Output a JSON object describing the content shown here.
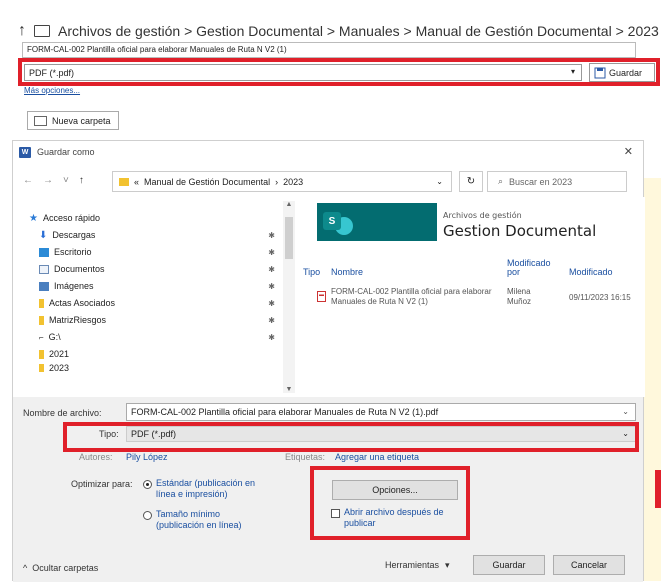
{
  "backstage": {
    "path": "Archivos de gestión > Gestion Documental > Manuales > Manual de Gestión Documental > 2023",
    "filename": "FORM-CAL-002 Plantilla oficial para elaborar Manuales de Ruta N V2 (1)",
    "type_value": "PDF (*.pdf)",
    "save_label": "Guardar",
    "more_options": "Más opciones...",
    "new_folder": "Nueva carpeta"
  },
  "dialog": {
    "title": "Guardar como",
    "address": {
      "location": "Manual de Gestión Documental",
      "separator": "›",
      "current": "2023",
      "search_placeholder": "Buscar en 2023"
    },
    "nav": [
      {
        "label": "Acceso rápido",
        "icon": "star-icon",
        "pinned": false
      },
      {
        "label": "Descargas",
        "icon": "download-icon",
        "pinned": true
      },
      {
        "label": "Escritorio",
        "icon": "desktop-icon",
        "pinned": true
      },
      {
        "label": "Documentos",
        "icon": "documents-icon",
        "pinned": true
      },
      {
        "label": "Imágenes",
        "icon": "pictures-icon",
        "pinned": true
      },
      {
        "label": "Actas Asociados",
        "icon": "folder-icon",
        "pinned": true
      },
      {
        "label": "MatrizRiesgos",
        "icon": "folder-icon",
        "pinned": true
      },
      {
        "label": "G:\\",
        "icon": "drive-icon",
        "pinned": true
      },
      {
        "label": "2021",
        "icon": "folder-icon",
        "pinned": false
      },
      {
        "label": "2023",
        "icon": "folder-icon",
        "pinned": false
      }
    ],
    "site": {
      "subtitle": "Archivos de gestión",
      "title": "Gestion Documental"
    },
    "columns": {
      "type": "Tipo",
      "name": "Nombre",
      "modified_by": "Modificado por",
      "modified": "Modificado"
    },
    "file": {
      "name": "FORM-CAL-002 Plantilla oficial para elaborar Manuales de Ruta N V2 (1)",
      "modified_by": "Milena Muñoz",
      "modified": "09/11/2023 16:15"
    },
    "fields": {
      "filename_label": "Nombre de archivo:",
      "filename_value": "FORM-CAL-002 Plantilla oficial para elaborar Manuales de Ruta N V2 (1).pdf",
      "type_label": "Tipo:",
      "type_value": "PDF (*.pdf)",
      "authors_label": "Autores:",
      "authors_value": "Pily López",
      "tags_label": "Etiquetas:",
      "tags_value": "Agregar una etiqueta",
      "optimize_label": "Optimizar para:",
      "option_standard": "Estándar (publicación en línea e impresión)",
      "option_min": "Tamaño mínimo (publicación en línea)",
      "options_button": "Opciones...",
      "open_after": "Abrir archivo después de publicar"
    },
    "footer": {
      "hide_folders": "Ocultar carpetas",
      "tools": "Herramientas",
      "save": "Guardar",
      "cancel": "Cancelar"
    }
  },
  "colors": {
    "highlight_red": "#e0202a",
    "sharepoint_teal": "#036c70",
    "link_blue": "#1a4fa0"
  }
}
